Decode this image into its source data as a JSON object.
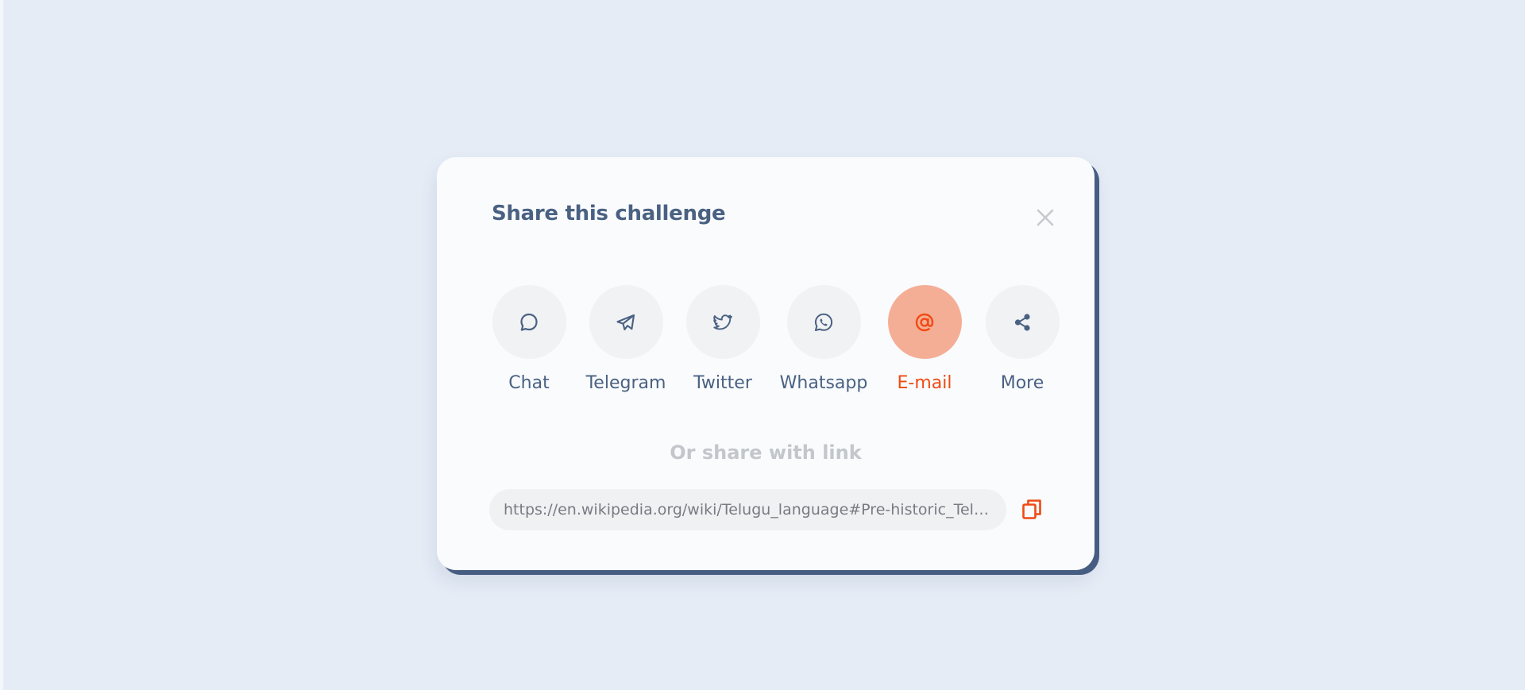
{
  "modal": {
    "title": "Share this challenge",
    "close_icon": "close-icon",
    "share_options": [
      {
        "label": "Chat",
        "icon": "chat-bubble-icon",
        "active": false
      },
      {
        "label": "Telegram",
        "icon": "telegram-plane-icon",
        "active": false
      },
      {
        "label": "Twitter",
        "icon": "twitter-bird-icon",
        "active": false
      },
      {
        "label": "Whatsapp",
        "icon": "whatsapp-icon",
        "active": false
      },
      {
        "label": "E-mail",
        "icon": "at-sign-icon",
        "active": true
      },
      {
        "label": "More",
        "icon": "share-nodes-icon",
        "active": false
      }
    ],
    "or_share_text": "Or share with link",
    "link_value": "https://en.wikipedia.org/wiki/Telugu_language#Pre-historic_Telugu_(...",
    "copy_icon": "copy-icon"
  },
  "colors": {
    "page_background": "#e5ecf6",
    "modal_background": "#f9fbfd",
    "text_primary": "#4a6182",
    "accent": "#f04a12",
    "accent_light": "#f5ae96",
    "muted_text": "#c3c6ca"
  }
}
